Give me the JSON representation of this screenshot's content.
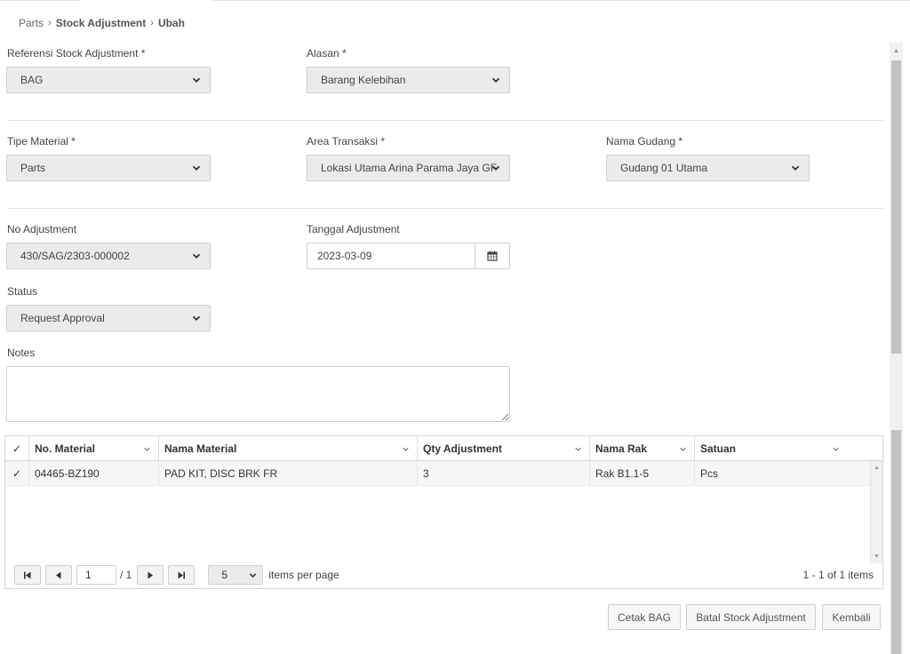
{
  "breadcrumb": {
    "root": "Parts",
    "middle": "Stock Adjustment",
    "current": "Ubah"
  },
  "form": {
    "referensi": {
      "label": "Referensi Stock Adjustment *",
      "value": "BAG"
    },
    "alasan": {
      "label": "Alasan *",
      "value": "Barang Kelebihan"
    },
    "tipe_material": {
      "label": "Tipe Material *",
      "value": "Parts"
    },
    "area_transaksi": {
      "label": "Area Transaksi *",
      "value": "Lokasi Utama Arina Parama Jaya GF"
    },
    "nama_gudang": {
      "label": "Nama Gudang *",
      "value": "Gudang 01 Utama"
    },
    "no_adjustment": {
      "label": "No Adjustment",
      "value": "430/SAG/2303-000002"
    },
    "tanggal": {
      "label": "Tanggal Adjustment",
      "value": "2023-03-09"
    },
    "status": {
      "label": "Status",
      "value": "Request Approval"
    },
    "notes": {
      "label": "Notes",
      "value": ""
    }
  },
  "grid": {
    "columns": [
      "No. Material",
      "Nama Material",
      "Qty Adjustment",
      "Nama Rak",
      "Satuan"
    ],
    "rows": [
      {
        "no_material": "04465-BZ190",
        "nama_material": "PAD KIT, DISC BRK FR",
        "qty": "3",
        "rak": "Rak B1.1-5",
        "satuan": "Pcs"
      }
    ],
    "pager": {
      "page": "1",
      "of": "/ 1",
      "page_size": "5",
      "items_per_page": "items per page",
      "info": "1 - 1 of 1 items"
    }
  },
  "buttons": {
    "cetak": "Cetak BAG",
    "batal": "Batal Stock Adjustment",
    "kembali": "Kembali"
  },
  "icons": {
    "chevron": "chevron-down-icon",
    "calendar": "calendar-icon",
    "check": "check-icon"
  }
}
